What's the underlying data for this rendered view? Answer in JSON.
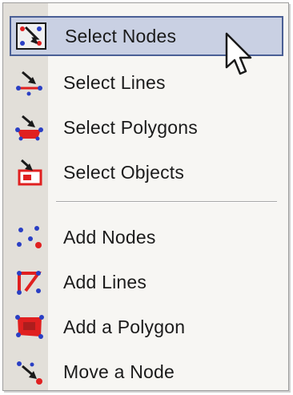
{
  "menu": {
    "items": [
      {
        "label": "Select Nodes",
        "icon": "select-nodes-icon",
        "selected": true
      },
      {
        "label": "Select Lines",
        "icon": "select-lines-icon"
      },
      {
        "label": "Select Polygons",
        "icon": "select-polygons-icon"
      },
      {
        "label": "Select Objects",
        "icon": "select-objects-icon"
      },
      {
        "label": "Add Nodes",
        "icon": "add-nodes-icon"
      },
      {
        "label": "Add Lines",
        "icon": "add-lines-icon"
      },
      {
        "label": "Add a Polygon",
        "icon": "add-polygon-icon"
      },
      {
        "label": "Move a Node",
        "icon": "move-node-icon"
      }
    ]
  },
  "colors": {
    "highlight_fill": "#c9d0e3",
    "highlight_border": "#4a5f95",
    "gutter": "#e2dfd9",
    "icon_red": "#e02020",
    "icon_blue": "#2a3fc4"
  }
}
